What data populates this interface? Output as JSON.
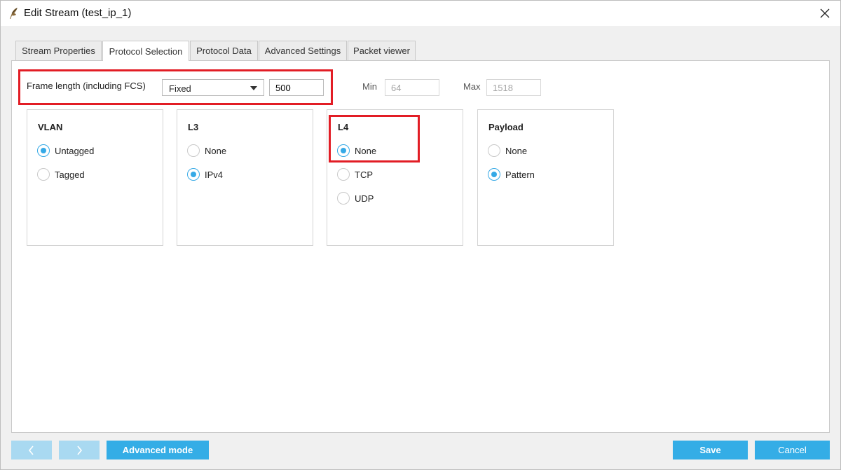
{
  "window": {
    "title": "Edit Stream (test_ip_1)"
  },
  "tabs": [
    {
      "label": "Stream Properties",
      "active": false
    },
    {
      "label": "Protocol Selection",
      "active": true
    },
    {
      "label": "Protocol Data",
      "active": false
    },
    {
      "label": "Advanced Settings",
      "active": false
    },
    {
      "label": "Packet viewer",
      "active": false
    }
  ],
  "frame_length": {
    "label": "Frame length (including FCS)",
    "mode_selected": "Fixed",
    "value": "500",
    "min_label": "Min",
    "min_value": "64",
    "max_label": "Max",
    "max_value": "1518"
  },
  "groups": {
    "vlan": {
      "title": "VLAN",
      "options": [
        {
          "label": "Untagged",
          "selected": true
        },
        {
          "label": "Tagged",
          "selected": false
        }
      ]
    },
    "l3": {
      "title": "L3",
      "options": [
        {
          "label": "None",
          "selected": false
        },
        {
          "label": "IPv4",
          "selected": true
        }
      ]
    },
    "l4": {
      "title": "L4",
      "options": [
        {
          "label": "None",
          "selected": true
        },
        {
          "label": "TCP",
          "selected": false
        },
        {
          "label": "UDP",
          "selected": false
        }
      ]
    },
    "payload": {
      "title": "Payload",
      "options": [
        {
          "label": "None",
          "selected": false
        },
        {
          "label": "Pattern",
          "selected": true
        }
      ]
    }
  },
  "footer": {
    "advanced_mode_label": "Advanced mode",
    "save_label": "Save",
    "cancel_label": "Cancel"
  },
  "colors": {
    "accent": "#35a9e6",
    "highlight": "#e21d25",
    "nav_disabled": "#a9d9f1"
  },
  "icons": {
    "app": "quill-icon",
    "close": "close-icon",
    "back": "chevron-left-icon",
    "forward": "chevron-right-icon",
    "dropdown": "caret-down-icon"
  }
}
